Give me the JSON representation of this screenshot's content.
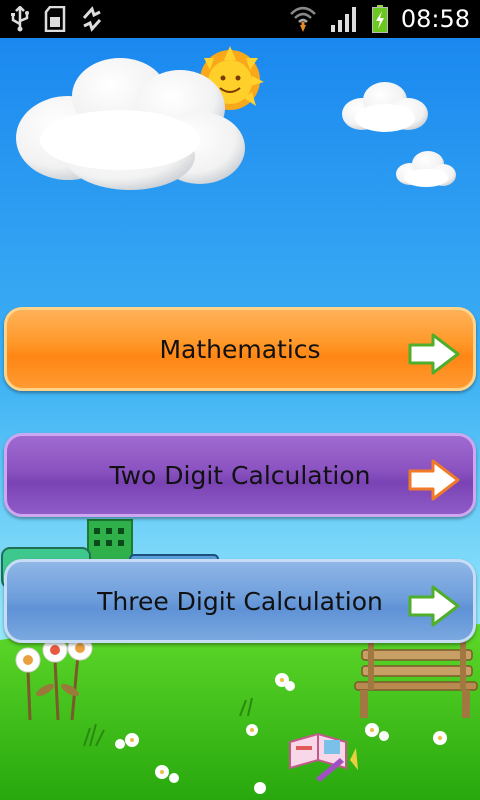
{
  "status_bar": {
    "time": "08:58",
    "icons": [
      "usb-icon",
      "sd-card-icon",
      "sync-icon",
      "wifi-icon",
      "signal-icon",
      "battery-charging-icon"
    ]
  },
  "menu": {
    "items": [
      {
        "label": "Mathematics",
        "icon": "arrow-right-icon",
        "color": "#ff8c1e"
      },
      {
        "label": "Two Digit Calculation",
        "icon": "arrow-right-icon",
        "color": "#8048b8"
      },
      {
        "label": "Three Digit Calculation",
        "icon": "arrow-right-icon",
        "color": "#6a9ad8"
      }
    ]
  },
  "colors": {
    "sky_top": "#1e8ef0",
    "sky_bottom": "#8fe4fa",
    "grass": "#38c018",
    "arrow_fill": "#ffffff"
  },
  "background": {
    "decorations": [
      "cloud-icon",
      "sun-icon",
      "flower-icon",
      "bench-icon",
      "school-book-icon"
    ]
  }
}
